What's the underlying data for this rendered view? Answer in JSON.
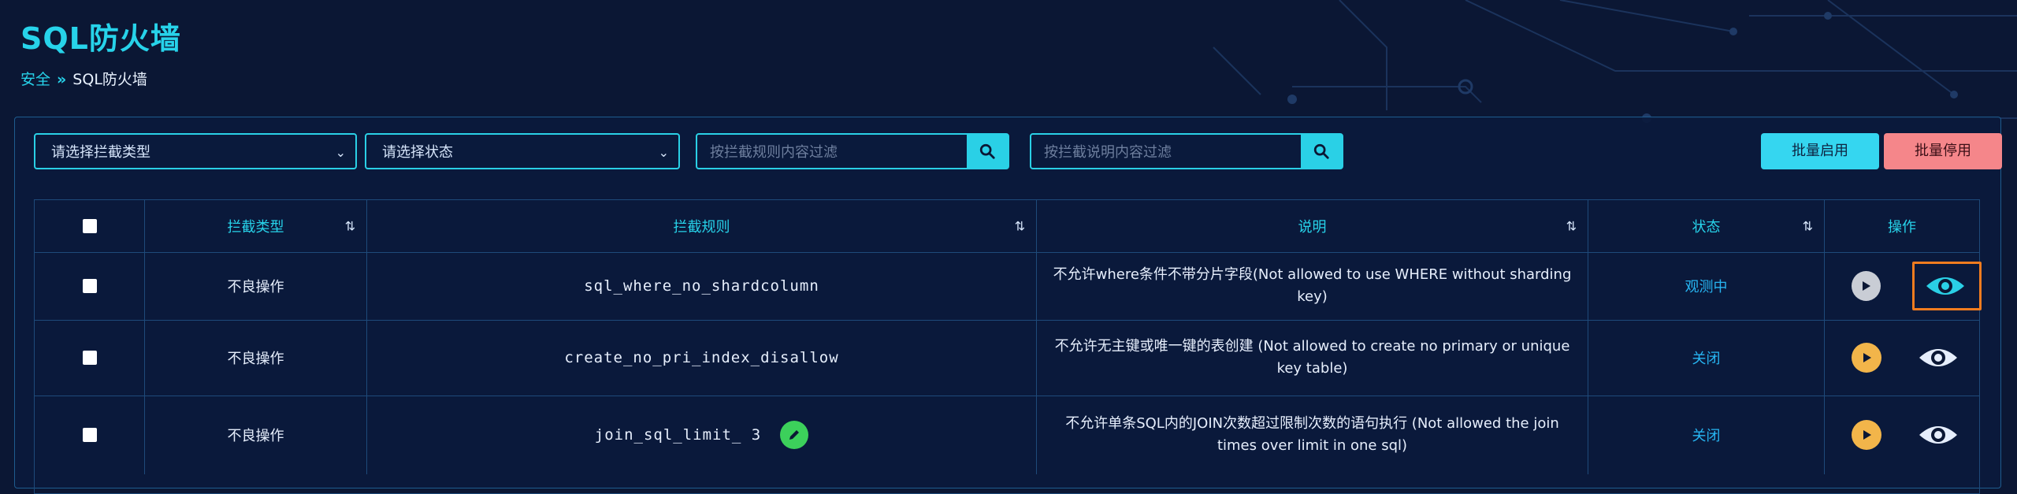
{
  "page": {
    "title": "SQL防火墙",
    "breadcrumb": [
      "安全",
      "SQL防火墙"
    ]
  },
  "filters": {
    "type_select": "请选择拦截类型",
    "status_select": "请选择状态",
    "rule_search_placeholder": "按拦截规则内容过滤",
    "desc_search_placeholder": "按拦截说明内容过滤"
  },
  "actions": {
    "batch_enable": "批量启用",
    "batch_disable": "批量停用"
  },
  "table": {
    "headers": {
      "type": "拦截类型",
      "rule": "拦截规则",
      "desc": "说明",
      "status": "状态",
      "ops": "操作"
    },
    "rows": [
      {
        "type": "不良操作",
        "rule": "sql_where_no_shardcolumn",
        "desc": "不允许where条件不带分片字段(Not allowed to use WHERE without sharding key)",
        "status": "观测中",
        "play_color": "#c9cdd5",
        "view_color": "#2ad0e6",
        "view_highlight": true,
        "editable": false
      },
      {
        "type": "不良操作",
        "rule": "create_no_pri_index_disallow",
        "desc": "不允许无主键或唯一键的表创建 (Not allowed to create no primary or unique key table)",
        "status": "关闭",
        "play_color": "#f2b54a",
        "view_color": "#e6eefc",
        "view_highlight": false,
        "editable": false
      },
      {
        "type": "不良操作",
        "rule": "join_sql_limit_ 3",
        "desc": "不允许单条SQL内的JOIN次数超过限制次数的语句执行 (Not allowed the join times over limit in one sql)",
        "status": "关闭",
        "play_color": "#f2b54a",
        "view_color": "#e6eefc",
        "view_highlight": false,
        "editable": true
      }
    ]
  }
}
